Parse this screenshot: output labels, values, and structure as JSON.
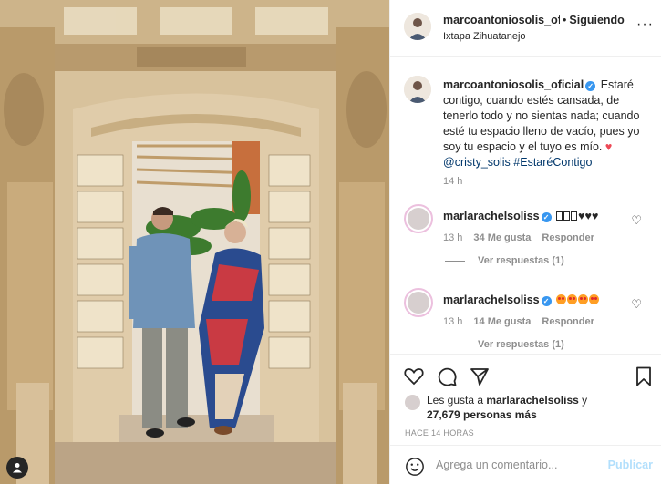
{
  "post": {
    "image_alt": "",
    "user_tag_icon": "person-icon"
  },
  "header": {
    "username": "marcoantoniosolis_ofi",
    "separator": "•",
    "follow_status": "Siguiendo",
    "location": "Ixtapa Zihuatanejo",
    "more_icon": "more-horizontal-icon"
  },
  "caption": {
    "username": "marcoantoniosolis_oficial",
    "text": "Estaré contigo, cuando estés cansada, de tenerlo todo y no sientas nada; cuando esté tu espacio lleno de vacío, pues yo soy tu espacio y el tuyo es mío.",
    "mention": "@cristy_solis",
    "hashtag": "#EstaréContigo",
    "time": "14 h"
  },
  "comments": [
    {
      "username": "marlarachelsoliss",
      "text_suffix": "♥♥♥",
      "time": "13 h",
      "likes": "34 Me gusta",
      "reply_label": "Responder",
      "replies_label": "Ver respuestas (1)"
    },
    {
      "username": "marlarachelsoliss",
      "time": "13 h",
      "likes": "14 Me gusta",
      "reply_label": "Responder",
      "replies_label": "Ver respuestas (1)"
    }
  ],
  "actions": {
    "liked_prefix": "Les gusta a",
    "liked_user": "marlarachelsoliss",
    "liked_conj": "y",
    "liked_others": "27,679 personas más",
    "post_age": "HACE 14 HORAS"
  },
  "composer": {
    "placeholder": "Agrega un comentario...",
    "publish_label": "Publicar"
  },
  "colors": {
    "verified": "#3897f0",
    "link": "#00376b",
    "publish_disabled": "#b2dffc",
    "heart": "#ed4956"
  }
}
